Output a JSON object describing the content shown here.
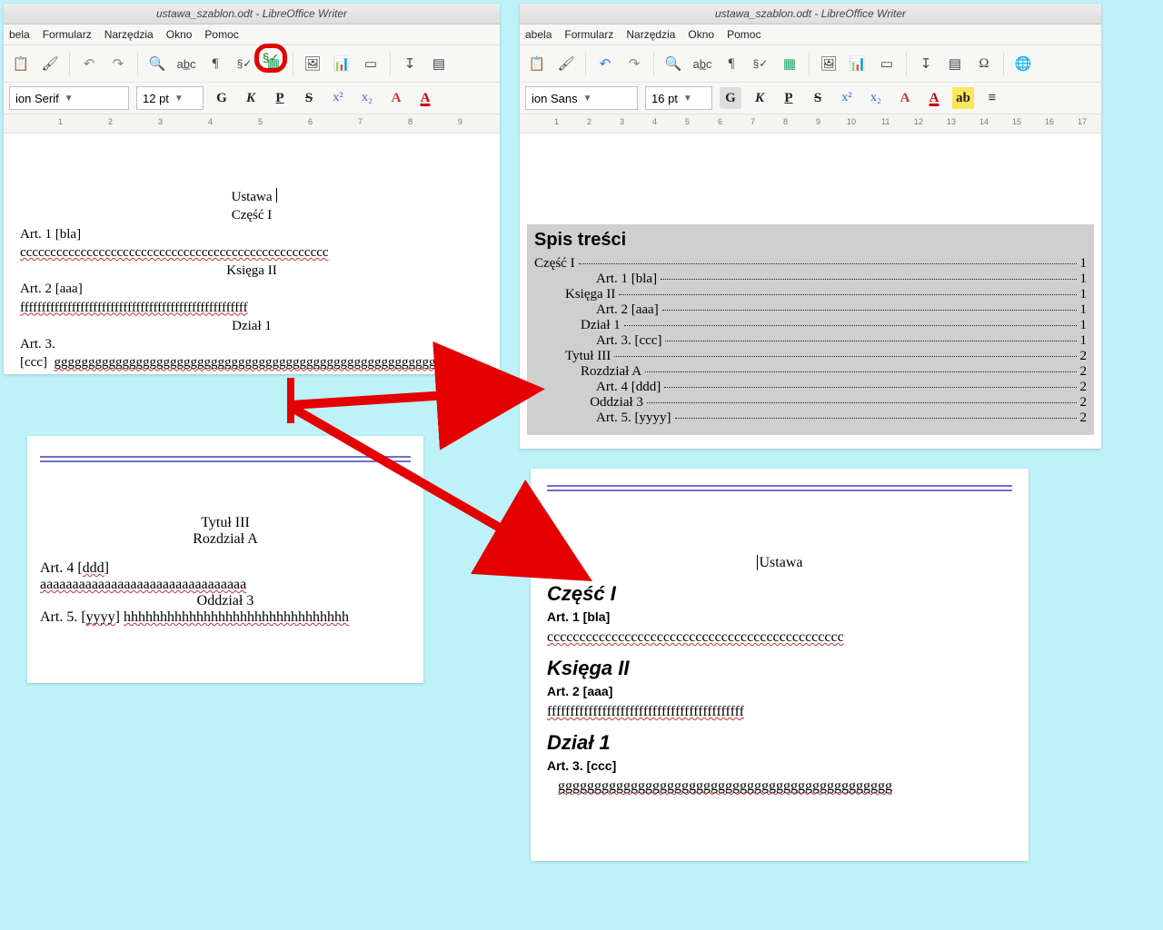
{
  "title": "ustawa_szablon.odt - LibreOffice Writer",
  "menu": [
    "bela",
    "Formularz",
    "Narzędzia",
    "Okno",
    "Pomoc"
  ],
  "menu2": [
    "abela",
    "Formularz",
    "Narzędzia",
    "Okno",
    "Pomoc"
  ],
  "font_left": {
    "name": "ion Serif",
    "size": "12 pt"
  },
  "font_right": {
    "name": "ion Sans",
    "size": "16 pt"
  },
  "fmt": {
    "bold": "G",
    "italic": "K",
    "under": "P",
    "strike": "S",
    "sup": "x²",
    "sub": "x₂",
    "clear": "A",
    "color": "A"
  },
  "ruler_left": [
    "1",
    "2",
    "3",
    "4",
    "5",
    "6",
    "7",
    "8",
    "9"
  ],
  "ruler_right": [
    "1",
    "2",
    "3",
    "4",
    "5",
    "6",
    "7",
    "8",
    "9",
    "10",
    "11",
    "12",
    "13",
    "14",
    "15",
    "16",
    "17"
  ],
  "doc1": {
    "ustawa": "Ustawa",
    "czesc": "Część I",
    "art1": "Art. 1 [bla]",
    "cc": "ccccccccccccccccccccccccccccccccccccccccccccccccccc",
    "ksiega": "Księga II",
    "art2": "Art. 2 [aaa]",
    "ff": "fffffffffffffffffffffffffffffffffffffffffffffffffffff",
    "dzial": "Dział 1",
    "art3": "Art. 3.  [ccc]",
    "gg": "ggggggggggggggggggggggggggggggggggggggggggggggggggggggggggg"
  },
  "doc2": {
    "tytul": "Tytuł III",
    "rozdzial": "Rozdział A",
    "art4": "Art. 4 [ddd]",
    "aa": "aaaaaaaaaaaaaaaaaaaaaaaaaaaaaaaa",
    "oddzial": "Oddział 3",
    "art5": "Art. 5. [yyyy]",
    "hh": "hhhhhhhhhhhhhhhhhhhhhhhhhhhhhhh"
  },
  "toc": {
    "title": "Spis treści",
    "rows": [
      {
        "label": "Część I",
        "page": "1",
        "indent": 0
      },
      {
        "label": "Art. 1 [bla]",
        "page": "1",
        "indent": 2
      },
      {
        "label": "Księga II",
        "page": "1",
        "indent": 1
      },
      {
        "label": "Art. 2 [aaa]",
        "page": "1",
        "indent": 2
      },
      {
        "label": "Dział 1",
        "page": "1",
        "indent": 1.5
      },
      {
        "label": "Art. 3. [ccc]",
        "page": "1",
        "indent": 2
      },
      {
        "label": "Tytuł III",
        "page": "2",
        "indent": 1
      },
      {
        "label": "Rozdział A",
        "page": "2",
        "indent": 1.5
      },
      {
        "label": "Art. 4 [ddd]",
        "page": "2",
        "indent": 2
      },
      {
        "label": "Oddział 3",
        "page": "2",
        "indent": 1.8
      },
      {
        "label": "Art. 5. [yyyy]",
        "page": "2",
        "indent": 2
      }
    ]
  },
  "doc4": {
    "ustawa": "Ustawa",
    "czesc": "Część I",
    "art1": "Art. 1 [bla]",
    "cc": "cccccccccccccccccccccccccccccccccccccccccccccc",
    "ksiega": "Księga II",
    "art2": "Art. 2 [aaa]",
    "ff": "fffffffffffffffffffffffffffffffffffffffffff",
    "dzial": "Dział 1",
    "art3": "Art. 3.  [ccc]",
    "gg": "gggggggggggggggggggggggggggggggggggggggggggggg"
  }
}
